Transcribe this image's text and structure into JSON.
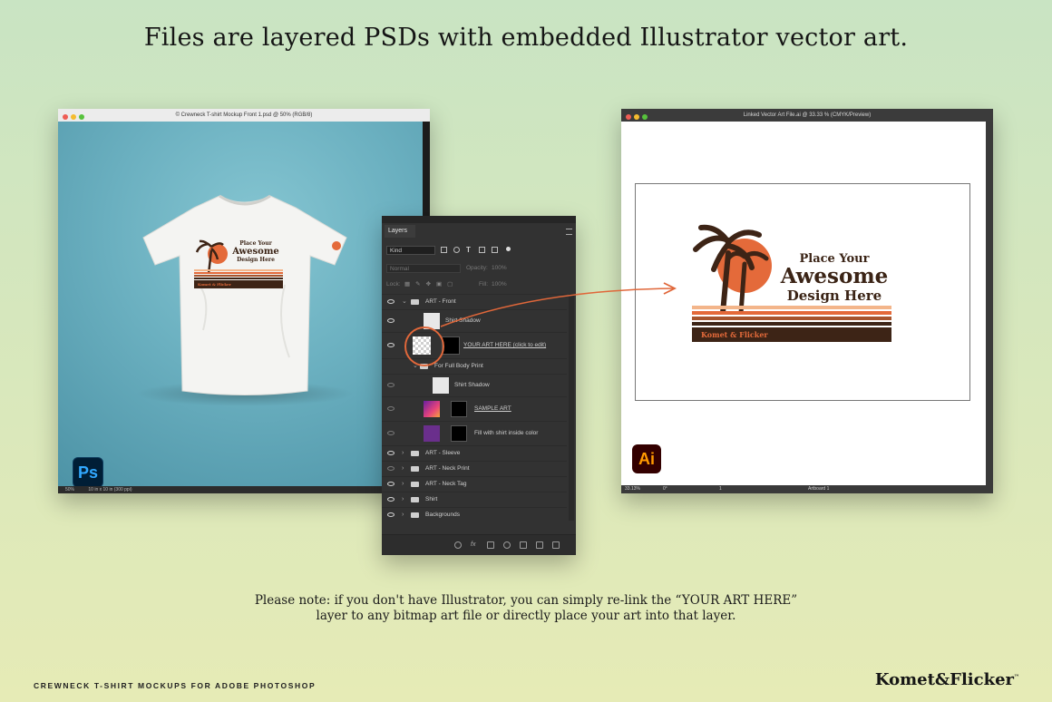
{
  "headline": "Files are layered PSDs with embedded Illustrator vector art.",
  "photoshop": {
    "title": "© Crewneck T-shirt Mockup Front 1.psd @ 50% (RGB/8)",
    "status_zoom": "50%",
    "status_doc": "10 in x 10 in (300 ppi)",
    "app_badge": "Ps"
  },
  "layers_panel": {
    "tab": "Layers",
    "kind": "Kind",
    "blend_mode": "Normal",
    "opacity_label": "Opacity:",
    "opacity_value": "100%",
    "lock_label": "Lock:",
    "fill_label": "Fill:",
    "fill_value": "100%",
    "layers": [
      {
        "name": "ART - Front"
      },
      {
        "name": "Shirt Shadow"
      },
      {
        "name": "YOUR ART HERE (click to edit)"
      },
      {
        "name": "For Full Body Print"
      },
      {
        "name": "Shirt Shadow"
      },
      {
        "name": "SAMPLE ART"
      },
      {
        "name": "Fill with shirt inside color"
      },
      {
        "name": "ART - Sleeve"
      },
      {
        "name": "ART - Neck Print"
      },
      {
        "name": "ART - Neck Tag"
      },
      {
        "name": "Shirt"
      },
      {
        "name": "Backgrounds"
      }
    ]
  },
  "illustrator": {
    "title": "Linked Vector Art File.ai @ 33.33 % (CMYK/Preview)",
    "status_zoom": "33.13%",
    "status_rotate": "0°",
    "status_page": "1",
    "status_artboard": "Artboard 1",
    "app_badge": "Ai"
  },
  "artwork": {
    "line1": "Place Your",
    "line2": "Awesome",
    "line3": "Design Here",
    "brand": "Komet & Flicker"
  },
  "note_line1": "Please note: if you don't have Illustrator, you can simply re-link the “YOUR ART HERE”",
  "note_line2": "layer to any bitmap art file or directly place your art into that layer.",
  "footer_left": "CREWNECK T-SHIRT MOCKUPS FOR ADOBE PHOTOSHOP",
  "footer_brand": "Komet&Flicker",
  "footer_tm": "™",
  "colors": {
    "accent_orange": "#e46a3a",
    "brown": "#3d2416",
    "photoshop_blue": "#31a8ff",
    "illustrator_orange": "#ff9a00"
  }
}
